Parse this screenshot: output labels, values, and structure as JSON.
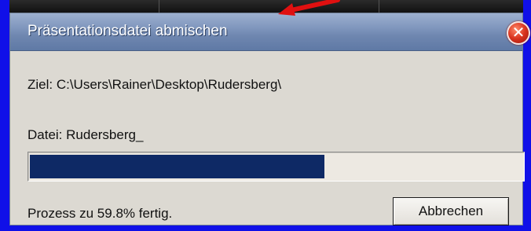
{
  "dialog": {
    "title": "Präsentationsdatei abmischen",
    "close_glyph": "✕",
    "target_label": "Ziel: C:\\Users\\Rainer\\Desktop\\Rudersberg\\",
    "file_label": "Datei: Rudersberg_",
    "progress_fraction": 0.598,
    "status_text": "Prozess zu 59.8% fertig.",
    "cancel_label": "Abbrechen"
  },
  "colors": {
    "frame_blue": "#1010e8",
    "progress_fill": "#0e2965",
    "dialog_bg": "#dcd9d2",
    "arrow_red": "#e01010"
  },
  "icons": {
    "close": "close-icon",
    "annotation": "red-arrow-icon"
  }
}
